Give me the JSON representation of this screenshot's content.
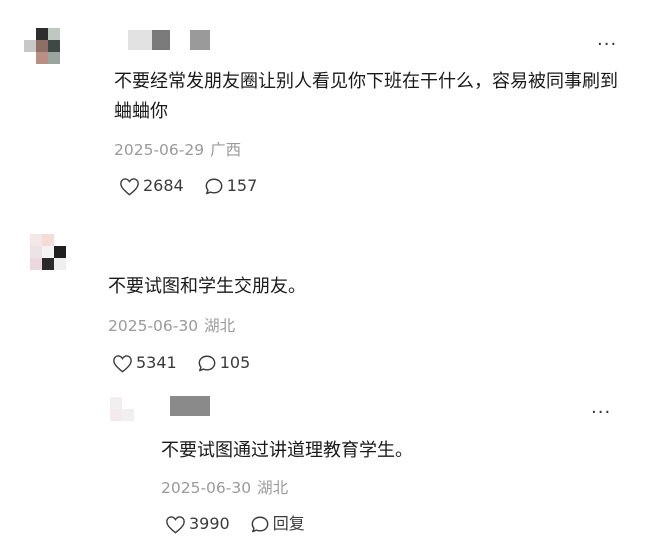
{
  "comments": [
    {
      "text": "不要经常发朋友圈让别人看见你下班在干什么，容易被同事刷到蛐蛐你",
      "date": "2025-06-29",
      "location": "广西",
      "likes": "2684",
      "replies": "157",
      "more": "···"
    },
    {
      "text": "不要试图和学生交朋友。",
      "date": "2025-06-30",
      "location": "湖北",
      "likes": "5341",
      "replies": "105"
    },
    {
      "text": "不要试图通过讲道理教育学生。",
      "date": "2025-06-30",
      "location": "湖北",
      "likes": "3990",
      "reply_label": "回复",
      "more": "···"
    }
  ],
  "icons": {
    "like": "heart-outline-icon",
    "comment": "speech-bubble-icon",
    "more": "more-dots-icon"
  },
  "colors": {
    "text": "#1a1a1a",
    "meta": "#9a9a9a",
    "action": "#3a3a3a"
  }
}
